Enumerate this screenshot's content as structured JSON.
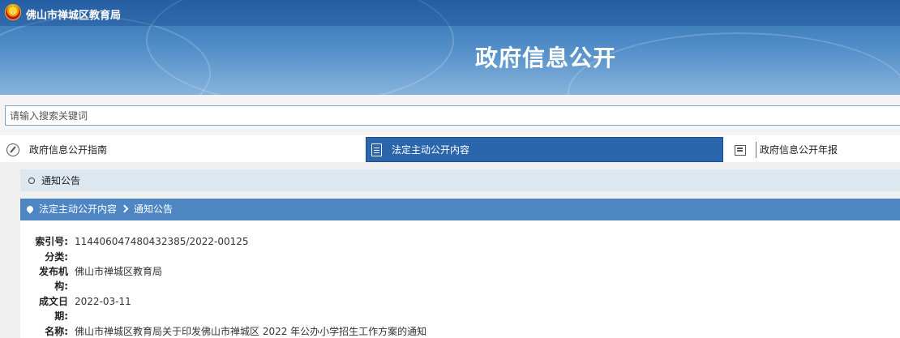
{
  "header": {
    "brand": "佛山市禅城区教育局",
    "title": "政府信息公开"
  },
  "search": {
    "placeholder": "请输入搜索关键词"
  },
  "nav": {
    "items": [
      {
        "label": "政府信息公开指南",
        "icon": "compass-icon",
        "active": false
      },
      {
        "label": "法定主动公开内容",
        "icon": "document-icon",
        "active": true
      },
      {
        "label": "政府信息公开年报",
        "icon": "report-icon",
        "active": false
      }
    ]
  },
  "section": {
    "title": "通知公告"
  },
  "breadcrumb": {
    "items": [
      "法定主动公开内容",
      "通知公告"
    ]
  },
  "detail": {
    "rows": [
      {
        "label": "索引号:",
        "value": "114406047480432385/2022-00125"
      },
      {
        "label": "分类:",
        "value": ""
      },
      {
        "label": "发布机构:",
        "value": "佛山市禅城区教育局"
      },
      {
        "label": "成文日期:",
        "value": "2022-03-11"
      },
      {
        "label": "名称:",
        "value": "佛山市禅城区教育局关于印发佛山市禅城区 2022 年公办小学招生工作方案的通知"
      }
    ]
  },
  "colors": {
    "banner": "#3f7dbd",
    "active_tab": "#2b66ad",
    "breadcrumb_bar": "#4e86c4",
    "section_bar": "#dde7f0"
  }
}
